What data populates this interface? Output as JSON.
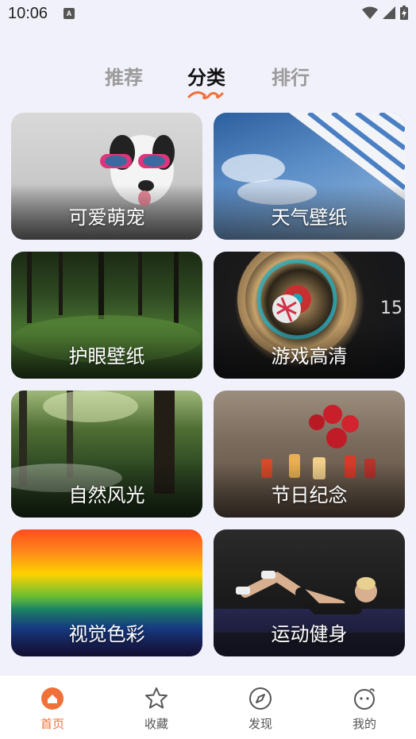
{
  "status_bar": {
    "time": "10:06",
    "notification_icon": "a-notification-icon"
  },
  "tabs": [
    {
      "label": "推荐",
      "active": false
    },
    {
      "label": "分类",
      "active": true
    },
    {
      "label": "排行",
      "active": false
    }
  ],
  "accent_color": "#f0703a",
  "categories": [
    {
      "label": "可爱萌宠"
    },
    {
      "label": "天气壁纸"
    },
    {
      "label": "护眼壁纸"
    },
    {
      "label": "游戏高清"
    },
    {
      "label": "自然风光"
    },
    {
      "label": "节日纪念"
    },
    {
      "label": "视觉色彩"
    },
    {
      "label": "运动健身"
    }
  ],
  "bottom_nav": [
    {
      "label": "首页",
      "icon": "home-icon",
      "active": true
    },
    {
      "label": "收藏",
      "icon": "star-icon",
      "active": false
    },
    {
      "label": "发现",
      "icon": "compass-icon",
      "active": false
    },
    {
      "label": "我的",
      "icon": "smiley-icon",
      "active": false
    }
  ]
}
